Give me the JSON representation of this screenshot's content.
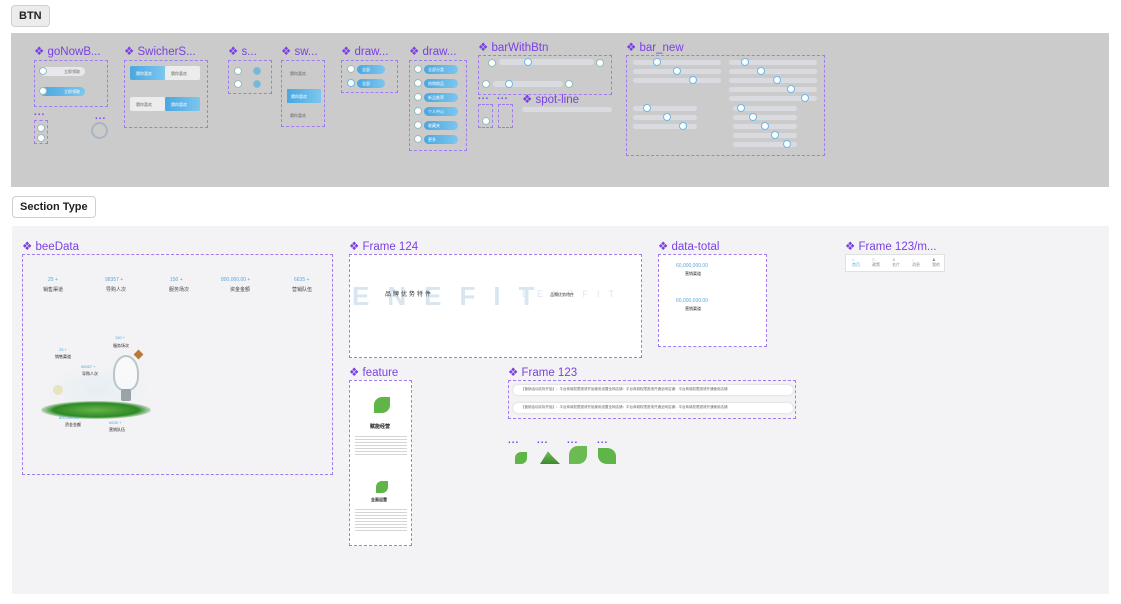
{
  "sections": {
    "btn": "BTN",
    "section_type": "Section Type"
  },
  "btn_components": [
    {
      "name": "goNowB..."
    },
    {
      "name": "SwicherS..."
    },
    {
      "name": "s..."
    },
    {
      "name": "sw..."
    },
    {
      "name": "draw..."
    },
    {
      "name": "draw..."
    },
    {
      "name": "barWithBtn"
    },
    {
      "name": "bar_new"
    },
    {
      "name": "spot-line"
    }
  ],
  "ellipsis": "...",
  "section_components": {
    "beeData": "beeData",
    "frame124": "Frame 124",
    "dataTotal": "data-total",
    "frame123m": "Frame 123/m...",
    "feature": "feature",
    "frame123": "Frame 123"
  },
  "beeData_stats": [
    {
      "value": "25 +",
      "label": "销售渠道"
    },
    {
      "value": "98357 +",
      "label": "导购人次"
    },
    {
      "value": "150 +",
      "label": "服务场次"
    },
    {
      "value": "800,000,00 +",
      "label": "资金金额"
    },
    {
      "value": "6635 +",
      "label": "营销队伍"
    }
  ],
  "frame124": {
    "bg_text": "ENEFIT",
    "small_bg_text": "BENEFIT",
    "center": "品牌优势特件",
    "right": "品牌优势特件"
  },
  "dataTotal": {
    "v1": "60,000,000.00",
    "l1": "营销渠道",
    "v2": "60,000,000.00",
    "l2": "营销渠道"
  },
  "nav_tabs": [
    "首页",
    "政策",
    "名片",
    "消息",
    "我的"
  ],
  "feature": {
    "t1": "赋能经营",
    "t2": "全面运营"
  },
  "frame123_rows": [
    "【营销活动实际开始】：平台商城权限邀请开始使用设置全网店铺：平台商城权限邀请开通全网店铺：平台商城权限邀请开通使用店铺",
    "【营销活动实际开始】：平台商城权限邀请开始使用设置全网店铺：平台商城权限邀请开通全网店铺：平台商城权限邀请开通使用店铺"
  ],
  "go_labels": [
    "立即领取",
    "立即领取"
  ],
  "switch_labels": [
    "猜你喜欢",
    "猜你喜欢",
    "猜你喜欢",
    "猜你喜欢"
  ],
  "sw_labels": [
    "猜你喜欢",
    "猜你喜欢",
    "猜你喜欢"
  ],
  "draw_labels": [
    "全部",
    "全部"
  ],
  "draw2_labels": [
    "全部分类",
    "热销商品",
    "新品推荐",
    "个人中心",
    "收藏夹",
    "更多"
  ]
}
